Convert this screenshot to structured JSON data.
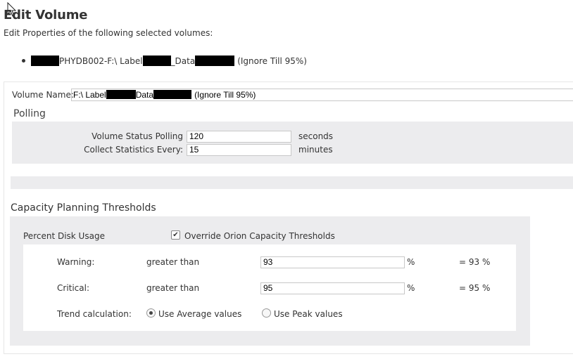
{
  "page": {
    "title": "Edit Volume",
    "subtitle": "Edit Properties of the following selected volumes:"
  },
  "selected_volume": {
    "part1": "PHYDB002-F:\\ Label",
    "part2": "_Data",
    "part3": "(Ignore Till 95%)"
  },
  "volume_name": {
    "label": "Volume Name:",
    "value_part1": "F:\\ Label",
    "value_part2": "Data",
    "value_part3": "(Ignore Till 95%)"
  },
  "polling": {
    "heading": "Polling",
    "status_label": "Volume Status Polling",
    "status_value": "120",
    "status_unit": "seconds",
    "stats_label": "Collect Statistics Every:",
    "stats_value": "15",
    "stats_unit": "minutes"
  },
  "capacity": {
    "heading": "Capacity Planning Thresholds",
    "percent_label": "Percent Disk Usage",
    "override_label": "Override Orion Capacity Thresholds",
    "override_checked": true,
    "warning": {
      "label": "Warning:",
      "op": "greater than",
      "value": "93",
      "unit": "%",
      "result": "= 93 %"
    },
    "critical": {
      "label": "Critical:",
      "op": "greater than",
      "value": "95",
      "unit": "%",
      "result": "= 95 %"
    },
    "trend": {
      "label": "Trend calculation:",
      "option_average": "Use Average values",
      "option_peak": "Use Peak values",
      "selected": "average"
    }
  },
  "icons": [
    "cursor-arrow-icon",
    "checkbox-checked-icon",
    "radio-selected-icon",
    "radio-unselected-icon"
  ]
}
